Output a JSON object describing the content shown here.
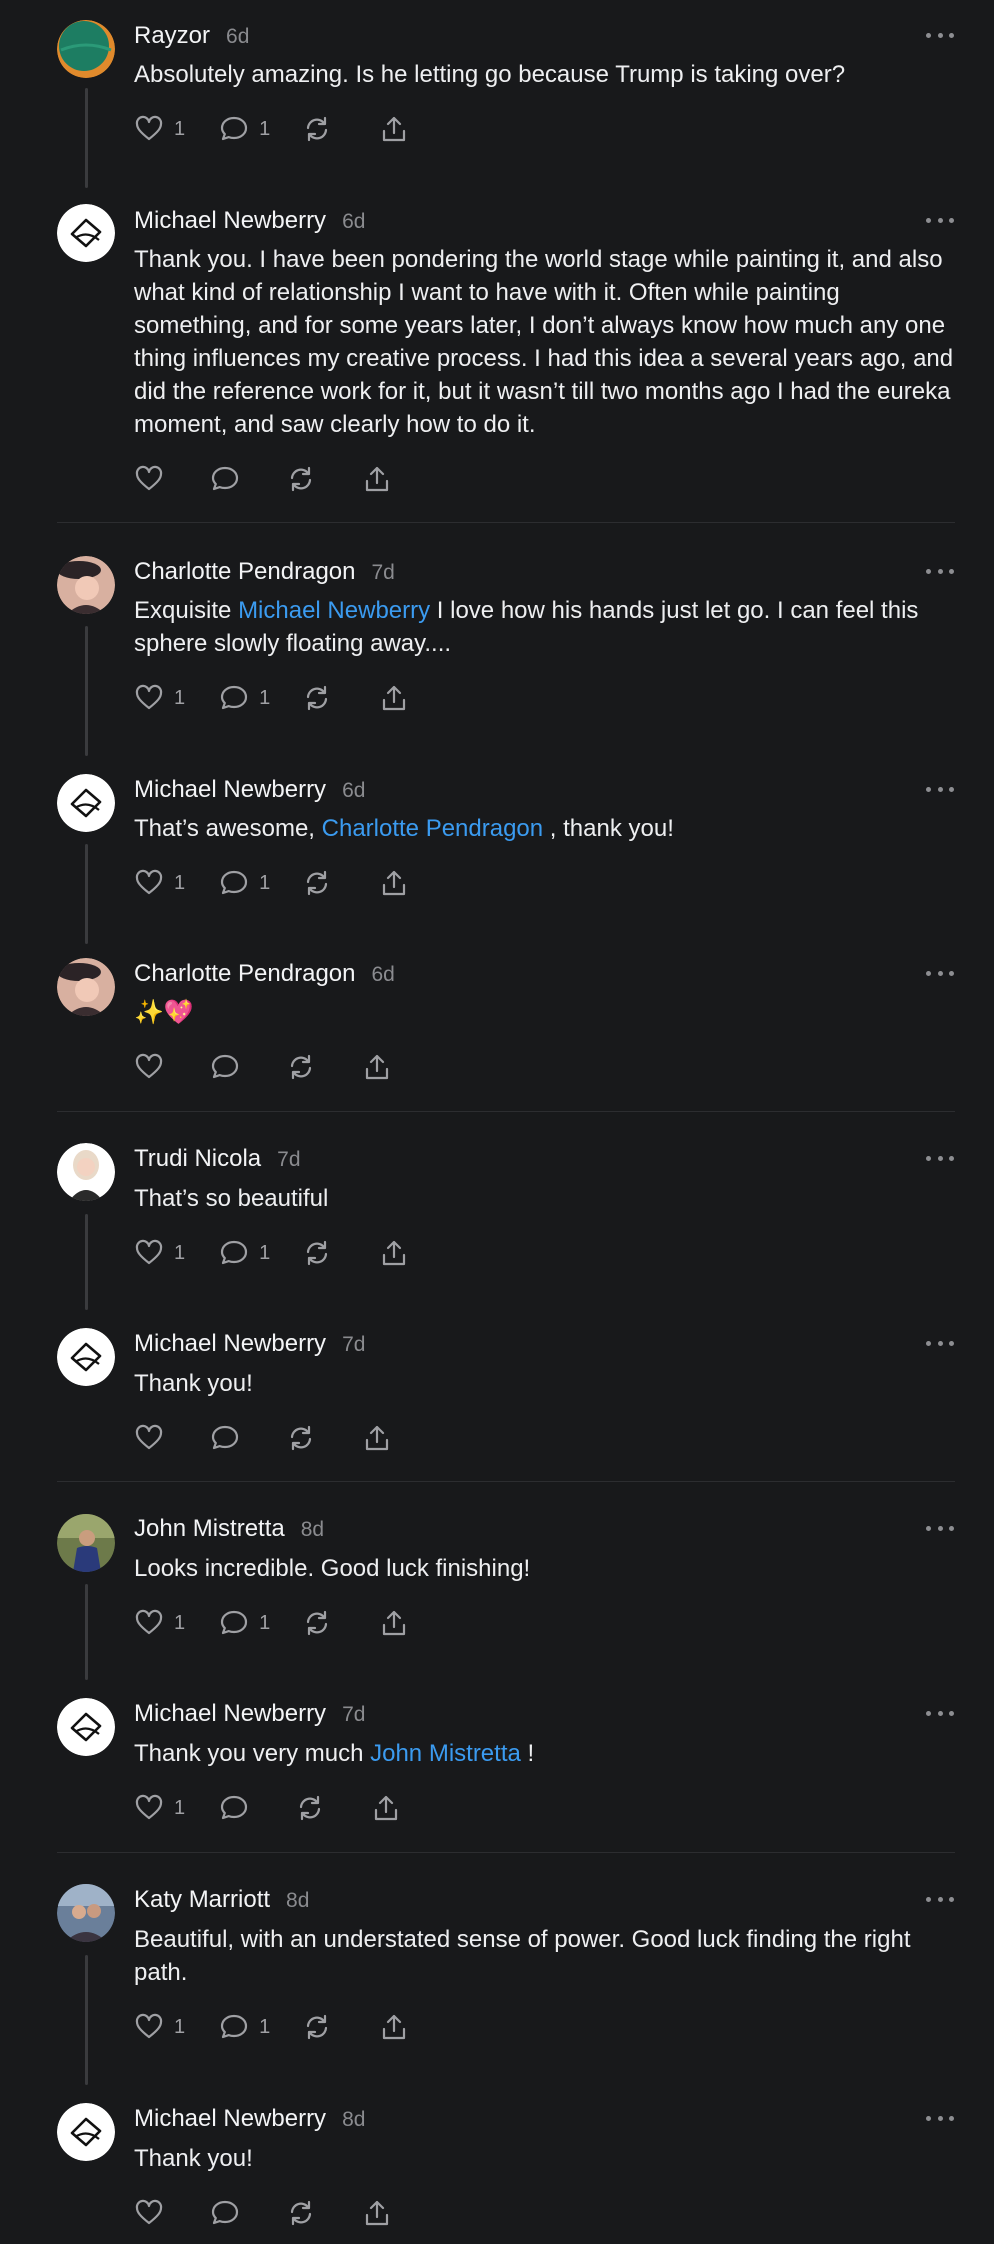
{
  "colors": {
    "background": "#18191b",
    "text": "#eeeff1",
    "muted": "#8a8b8f",
    "mention": "#3b9bf0",
    "thread_line": "#3a3b3e"
  },
  "icons": {
    "like": "heart-icon",
    "reply": "comment-icon",
    "repost": "repost-icon",
    "share": "share-icon",
    "more": "more-icon"
  },
  "posts": [
    {
      "name": "Rayzor",
      "time": "6d",
      "text": [
        "Absolutely amazing. Is he letting go because Trump is taking over?"
      ],
      "likes": "1",
      "replies": "1"
    },
    {
      "name": "Michael Newberry",
      "time": "6d",
      "text": [
        "Thank you. I have been pondering the world stage while painting it, and also what kind of relationship I want to have with it. Often while painting something, and for some years later, I don’t always know how much any one thing influences my creative process. I had this idea a several years ago, and did the reference work for it, but it wasn’t till two months ago I had the eureka moment, and saw clearly how to do it."
      ],
      "likes": "",
      "replies": ""
    },
    {
      "name": "Charlotte Pendragon",
      "time": "7d",
      "text": [
        "Exquisite ",
        "Michael Newberry",
        " I love how his hands just let go. I can feel this sphere slowly floating away...."
      ],
      "likes": "1",
      "replies": "1"
    },
    {
      "name": "Michael Newberry",
      "time": "6d",
      "text": [
        "That’s awesome, ",
        "Charlotte Pendragon",
        " , thank you!"
      ],
      "likes": "1",
      "replies": "1"
    },
    {
      "name": "Charlotte Pendragon",
      "time": "6d",
      "text": [
        "✨💖"
      ],
      "likes": "",
      "replies": ""
    },
    {
      "name": "Trudi Nicola",
      "time": "7d",
      "text": [
        "That’s so beautiful"
      ],
      "likes": "1",
      "replies": "1"
    },
    {
      "name": "Michael Newberry",
      "time": "7d",
      "text": [
        "Thank you!"
      ],
      "likes": "",
      "replies": ""
    },
    {
      "name": "John Mistretta",
      "time": "8d",
      "text": [
        "Looks incredible. Good luck finishing!"
      ],
      "likes": "1",
      "replies": "1"
    },
    {
      "name": "Michael Newberry",
      "time": "7d",
      "text": [
        "Thank you very much ",
        "John Mistretta",
        " !"
      ],
      "likes": "1",
      "replies": ""
    },
    {
      "name": "Katy Marriott",
      "time": "8d",
      "text": [
        "Beautiful, with an understated sense of power. Good luck finding the right path."
      ],
      "likes": "1",
      "replies": "1"
    },
    {
      "name": "Michael Newberry",
      "time": "8d",
      "text": [
        "Thank you!"
      ],
      "likes": "",
      "replies": ""
    }
  ]
}
